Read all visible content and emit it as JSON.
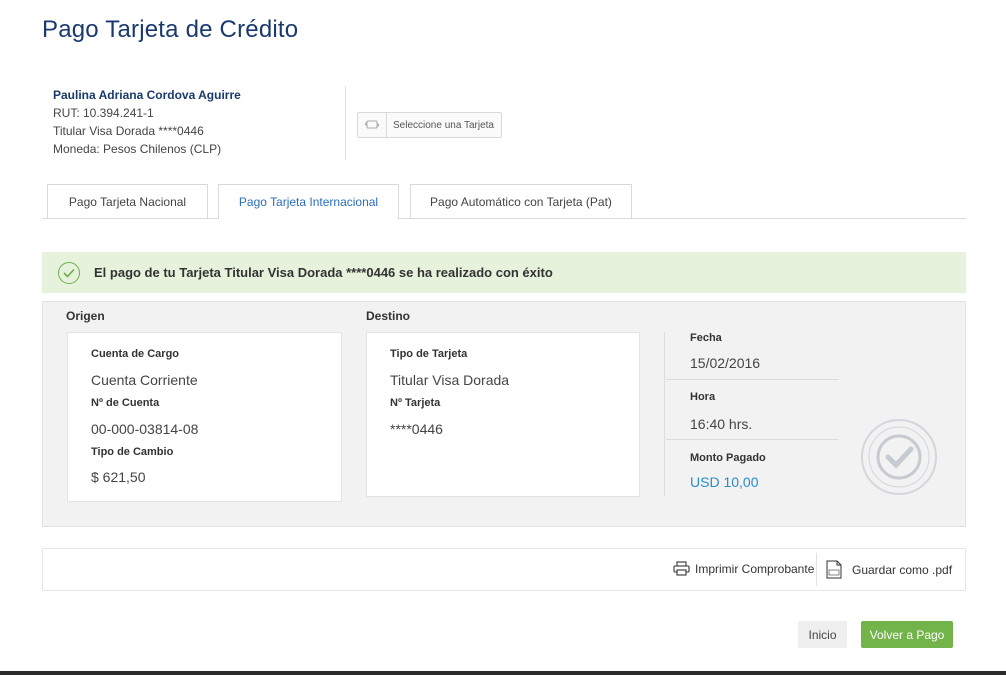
{
  "page": {
    "title": "Pago Tarjeta de Crédito"
  },
  "client": {
    "name": "Paulina Adriana Cordova Aguirre",
    "rut": "RUT: 10.394.241-1",
    "card": "Titular Visa Dorada ****0446",
    "currency": "Moneda: Pesos Chilenos (CLP)"
  },
  "card_selector": {
    "label": "Seleccione una Tarjeta",
    "icon": "card-swap-icon"
  },
  "tabs": [
    {
      "label": "Pago Tarjeta Nacional"
    },
    {
      "label": "Pago Tarjeta Internacional"
    },
    {
      "label": "Pago Automático con Tarjeta (Pat)"
    }
  ],
  "active_tab": 1,
  "success": {
    "message": "El pago de tu Tarjeta Titular Visa Dorada ****0446 se ha realizado con éxito",
    "icon": "check-circle-icon",
    "color": "#6ab04c"
  },
  "origin": {
    "title": "Origen",
    "account_label": "Cuenta de Cargo",
    "account_value": "Cuenta Corriente",
    "number_label": "Nº de Cuenta",
    "number_value": "00-000-03814-08",
    "rate_label": "Tipo de Cambio",
    "rate_value": "$ 621,50"
  },
  "destination": {
    "title": "Destino",
    "type_label": "Tipo de Tarjeta",
    "type_value": "Titular Visa Dorada",
    "number_label": "Nº Tarjeta",
    "number_value": "****0446"
  },
  "summary": {
    "date_label": "Fecha",
    "date_value": "15/02/2016",
    "time_label": "Hora",
    "time_value": "16:40 hrs.",
    "amount_label": "Monto Pagado",
    "amount_value": "USD 10,00",
    "amount_color": "#2a8ccb"
  },
  "actions": {
    "print_label": "Imprimir Comprobante",
    "pdf_label": "Guardar como .pdf",
    "print_icon": "printer-icon",
    "pdf_icon": "pdf-file-icon"
  },
  "buttons": {
    "home_label": "Inicio",
    "back_label": "Volver a Pago",
    "back_color": "#72b34a"
  }
}
